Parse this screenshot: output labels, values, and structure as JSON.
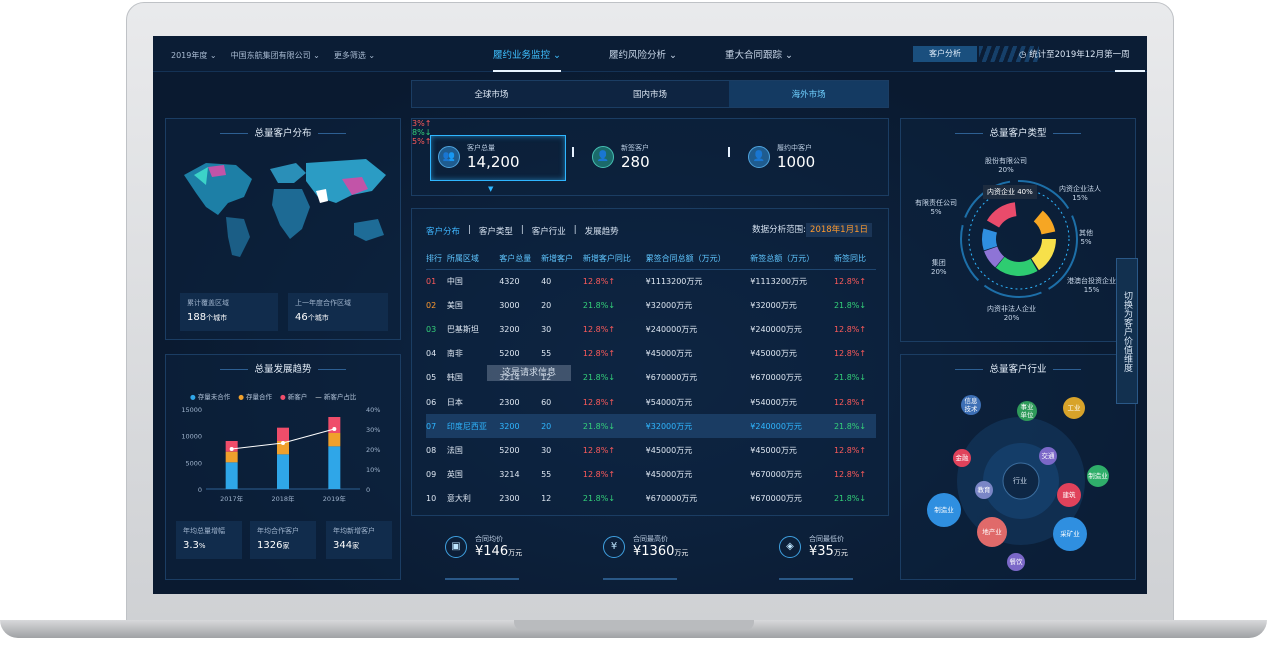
{
  "topbar": {
    "filters": [
      "2019年度 ⌄",
      "中国东航集团有限公司 ⌄",
      "更多筛选 ⌄"
    ],
    "nav": [
      "履约业务监控 ⌄",
      "履约风险分析 ⌄",
      "重大合同跟踪 ⌄"
    ],
    "customer_button": "客户分析",
    "stat_time": "统计至2019年12月第一周"
  },
  "left": {
    "dist_title": "总量客户分布",
    "box1_label": "累计覆盖区域",
    "box1_value": "188",
    "box1_unit": "个城市",
    "box2_label": "上一年度合作区域",
    "box2_value": "46",
    "box2_unit": "个城市",
    "trend_title": "总量发展趋势",
    "legend": [
      "存量未合作",
      "存量合作",
      "新客户",
      "新客户占比"
    ],
    "ylabels_left": [
      "15000",
      "10000",
      "5000",
      "0"
    ],
    "ylabels_right": [
      "40%",
      "30%",
      "20%",
      "10%",
      "0"
    ],
    "s1_label": "年均总量增幅",
    "s1_value": "3.3",
    "s1_unit": "%",
    "s2_label": "年均合作客户",
    "s2_value": "1326",
    "s2_unit": "家",
    "s3_label": "年均新增客户",
    "s3_value": "344",
    "s3_unit": "家"
  },
  "chart_data": {
    "type": "bar",
    "categories": [
      "2017年",
      "2018年",
      "2019年"
    ],
    "series": [
      {
        "name": "存量未合作",
        "values": [
          5000,
          6500,
          8000
        ]
      },
      {
        "name": "存量合作",
        "values": [
          2000,
          2500,
          2500
        ]
      },
      {
        "name": "新客户",
        "values": [
          2000,
          2500,
          3000
        ]
      },
      {
        "name": "新客户占比",
        "values": [
          20,
          23,
          30
        ]
      }
    ],
    "ylim": [
      0,
      15000
    ],
    "y2lim": [
      0,
      40
    ]
  },
  "market_tabs": [
    "全球市场",
    "国内市场",
    "海外市场"
  ],
  "kpis": [
    {
      "label": "客户总量",
      "value": "14,200",
      "change": "3%↑",
      "dir": "up"
    },
    {
      "label": "新签客户",
      "value": "280",
      "change": "8%↓",
      "dir": "down"
    },
    {
      "label": "履约中客户",
      "value": "1000",
      "change": "5%↑",
      "dir": "up"
    }
  ],
  "table": {
    "tabs": [
      "客户分布",
      "客户类型",
      "客户行业",
      "发展趋势"
    ],
    "range_label": "数据分析范围:",
    "range_value": "2018年1月1日",
    "headers": [
      "排行",
      "所属区域",
      "客户总量",
      "新增客户",
      "新增客户同比",
      "累签合同总额（万元）",
      "新签总额（万元）",
      "新签同比"
    ],
    "rows": [
      [
        "01",
        "中国",
        "4320",
        "40",
        "12.8%↑",
        "¥1113200万元",
        "¥1113200万元",
        "12.8%↑"
      ],
      [
        "02",
        "美国",
        "3000",
        "20",
        "21.8%↓",
        "¥32000万元",
        "¥32000万元",
        "21.8%↓"
      ],
      [
        "03",
        "巴基斯坦",
        "3200",
        "30",
        "12.8%↑",
        "¥240000万元",
        "¥240000万元",
        "12.8%↑"
      ],
      [
        "04",
        "南非",
        "5200",
        "55",
        "12.8%↑",
        "¥45000万元",
        "¥45000万元",
        "12.8%↑"
      ],
      [
        "05",
        "韩国",
        "3214",
        "12",
        "21.8%↓",
        "¥670000万元",
        "¥670000万元",
        "21.8%↓"
      ],
      [
        "06",
        "日本",
        "2300",
        "60",
        "12.8%↑",
        "¥54000万元",
        "¥54000万元",
        "12.8%↑"
      ],
      [
        "07",
        "印度尼西亚",
        "3200",
        "20",
        "21.8%↓",
        "¥32000万元",
        "¥240000万元",
        "21.8%↓"
      ],
      [
        "08",
        "法国",
        "5200",
        "30",
        "12.8%↑",
        "¥45000万元",
        "¥45000万元",
        "12.8%↑"
      ],
      [
        "09",
        "英国",
        "3214",
        "55",
        "12.8%↑",
        "¥45000万元",
        "¥670000万元",
        "12.8%↑"
      ],
      [
        "10",
        "意大利",
        "2300",
        "12",
        "21.8%↓",
        "¥670000万元",
        "¥670000万元",
        "21.8%↓"
      ]
    ],
    "watermark": "这是请求信息"
  },
  "bottom_stats": [
    {
      "label": "合同均价",
      "value": "¥146",
      "unit": "万元"
    },
    {
      "label": "合同最高价",
      "value": "¥1360",
      "unit": "万元"
    },
    {
      "label": "合同最低价",
      "value": "¥35",
      "unit": "万元"
    }
  ],
  "right": {
    "type_title": "总量客户类型",
    "type_labels": [
      "股份有限公司\n20%",
      "内资企业法人\n15%",
      "其他\n5%",
      "港澳台投资企业\n15%",
      "内资非法人企业\n20%",
      "集团\n20%",
      "有限责任公司\n5%"
    ],
    "type_tooltip": "内资企业  40%",
    "industry_title": "总量客户行业",
    "industry_center": "行业",
    "industry_bubbles": [
      "信息\n技术",
      "事业\n单位",
      "工业",
      "金融",
      "交通",
      "制造业",
      "教育",
      "建筑",
      "制造业",
      "地产业",
      "采矿业",
      "餐饮"
    ],
    "side_tab": "切换为客户价值维度"
  },
  "colors": {
    "accent": "#2fb6ff",
    "up": "#ff5b5b",
    "down": "#34d17a",
    "bg": "#0a1a30"
  }
}
